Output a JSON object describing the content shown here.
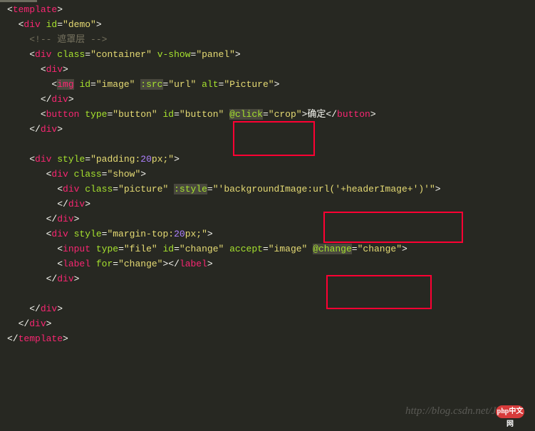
{
  "lines": {
    "l1_open": "<",
    "l1_tag": "template",
    "l1_close": ">",
    "l2_open": "<",
    "l2_tag": "div",
    "l2_attr": " id",
    "l2_eq": "=",
    "l2_val": "\"demo\"",
    "l2_close": ">",
    "l3": "<!-- 遮罩层 -->",
    "l4_open": "<",
    "l4_tag": "div",
    "l4_a1": " class",
    "l4_v1": "\"container\"",
    "l4_a2": " v-show",
    "l4_v2": "\"panel\"",
    "l4_close": ">",
    "l5_open": "<",
    "l5_tag": "div",
    "l5_close": ">",
    "l6_open": "<",
    "l6_tag": "img",
    "l6_a1": " id",
    "l6_v1": "\"image\"",
    "l6_a2": " :src",
    "l6_v2": "\"url\"",
    "l6_a3": " alt",
    "l6_v3": "\"Picture\"",
    "l6_close": ">",
    "l7_open": "</",
    "l7_tag": "div",
    "l7_close": ">",
    "l8_open": "<",
    "l8_tag": "button",
    "l8_a1": " type",
    "l8_v1": "\"button\"",
    "l8_a2": " id",
    "l8_v2": "\"button\"",
    "l8_a3": " @click",
    "l8_v3": "\"crop\"",
    "l8_txt": "确定",
    "l8_close": "</",
    "l8_tag2": "button",
    "l8_close2": ">",
    "l9_open": "</",
    "l9_tag": "div",
    "l9_close": ">",
    "l11_open": "<",
    "l11_tag": "div",
    "l11_a1": " style",
    "l11_v1a": "\"padding:",
    "l11_v1b": "20",
    "l11_v1c": "px;\"",
    "l11_close": ">",
    "l12_open": "<",
    "l12_tag": "div",
    "l12_a1": " class",
    "l12_v1": "\"show\"",
    "l12_close": ">",
    "l13_open": "<",
    "l13_tag": "div",
    "l13_a1": " class",
    "l13_v1": "\"picture\"",
    "l13_a2": " :style",
    "l13_v2": "\"'backgroundImage:url('+headerImage+')'\"",
    "l13_close": ">",
    "l14_open": "</",
    "l14_tag": "div",
    "l14_close": ">",
    "l15_open": "</",
    "l15_tag": "div",
    "l15_close": ">",
    "l16_open": "<",
    "l16_tag": "div",
    "l16_a1": " style",
    "l16_v1a": "\"margin-top:",
    "l16_v1b": "20",
    "l16_v1c": "px;\"",
    "l16_close": ">",
    "l17_open": "<",
    "l17_tag": "input",
    "l17_a1": " type",
    "l17_v1": "\"file\"",
    "l17_a2": " id",
    "l17_v2": "\"change\"",
    "l17_a3": " accept",
    "l17_v3": "\"image\"",
    "l17_a4": " @change",
    "l17_v4": "\"change\"",
    "l17_close": ">",
    "l18_open": "<",
    "l18_tag": "label",
    "l18_a1": " for",
    "l18_v1": "\"change\"",
    "l18_close": "></",
    "l18_tag2": "label",
    "l18_close2": ">",
    "l19_open": "</",
    "l19_tag": "div",
    "l19_close": ">",
    "l21_open": "</",
    "l21_tag": "div",
    "l21_close": ">",
    "l22_open": "</",
    "l22_tag": "div",
    "l22_close": ">",
    "l23_open": "</",
    "l23_tag": "template",
    "l23_close": ">"
  },
  "watermark": {
    "url": "http://blog.csdn.net/Ja",
    "logo": "php中文网"
  },
  "annotation_boxes": {
    "box1": {
      "target": "@click=\"crop\""
    },
    "box2": {
      "target": "backgroundImage:url('+headerImage+')'"
    },
    "box3": {
      "target": "@change=\"change\""
    }
  }
}
